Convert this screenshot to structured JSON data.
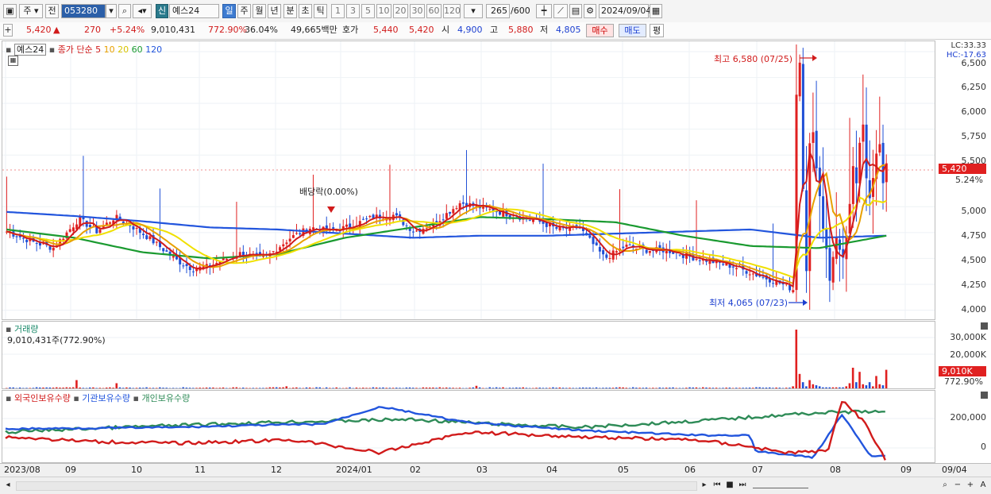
{
  "toolbar": {
    "period_label": "주",
    "prev_label": "전",
    "code": "053280",
    "credit_tag": "신",
    "stock_name": "예스24",
    "tabs": [
      "일",
      "주",
      "월",
      "년",
      "분",
      "초",
      "틱"
    ],
    "active_tab": "일",
    "intervals": [
      "1",
      "3",
      "5",
      "10",
      "20",
      "30",
      "60",
      "120"
    ],
    "count": "265",
    "count_max": "/600",
    "date": "2024/09/04"
  },
  "info": {
    "price": "5,420",
    "arrow": "▲",
    "change": "270",
    "change_pct": "+5.24%",
    "volume": "9,010,431",
    "volume_ratio": "772.90%",
    "turnover": "36.04%",
    "amount": "49,665백만",
    "bid_label": "호가",
    "bid": "5,440",
    "ask": "5,420",
    "open_label": "시",
    "open": "4,900",
    "high_label": "고",
    "high": "5,880",
    "low_label": "저",
    "low": "4,805",
    "buy_label": "매수",
    "sell_label": "매도",
    "flat_label": "평"
  },
  "price_pane": {
    "name_tag": "예스24",
    "ma_title": "종가 단순",
    "ma_periods": [
      "5",
      "10",
      "20",
      "60",
      "120"
    ],
    "ma_colors": [
      "#d11b1b",
      "#e8a000",
      "#f0e000",
      "#1a9a30",
      "#2255dd"
    ],
    "lc": "LC:33.33",
    "hc": "HC:-17.63",
    "high_note": "최고 6,580 (07/25)",
    "low_note": "최저 4,065 (07/23)",
    "dividend_note": "배당락(0.00%)",
    "current_price": "5,420",
    "current_pct": "5.24%",
    "yticks": [
      "6,500",
      "6,250",
      "6,000",
      "5,750",
      "5,500",
      "5,000",
      "4,750",
      "4,500",
      "4,250",
      "4,000"
    ]
  },
  "volume_pane": {
    "title": "거래량",
    "value": "9,010,431주(772.90%)",
    "yticks": [
      "30,000K",
      "20,000K"
    ],
    "current": "9,010K",
    "current_pct": "772.90%"
  },
  "holdings_pane": {
    "series": [
      "외국인보유수량",
      "기관보유수량",
      "개인보유수량"
    ],
    "colors": [
      "#d11b1b",
      "#2255dd",
      "#2e8b57"
    ],
    "yticks": [
      "200,000",
      "0"
    ]
  },
  "xaxis": {
    "labels": [
      "2023/08",
      "09",
      "10",
      "11",
      "12",
      "2024/01",
      "02",
      "03",
      "04",
      "05",
      "06",
      "07",
      "08",
      "09"
    ],
    "right_label": "09/04"
  },
  "chart_data": {
    "type": "candlestick",
    "title": "예스24",
    "last_close": 5420,
    "period_high": 6580,
    "period_low": 4065,
    "ylim": [
      3950,
      6600
    ],
    "x": [
      "2023/08",
      "09",
      "10",
      "11",
      "12",
      "2024/01",
      "02",
      "03",
      "04",
      "05",
      "06",
      "07",
      "08",
      "09"
    ],
    "ma120": [
      4950,
      4910,
      4860,
      4800,
      4780,
      4740,
      4700,
      4720,
      4720,
      4740,
      4760,
      4780,
      4700,
      4720
    ],
    "ma60": [
      4780,
      4700,
      4560,
      4500,
      4540,
      4700,
      4800,
      4900,
      4880,
      4850,
      4720,
      4620,
      4600,
      4720
    ]
  }
}
